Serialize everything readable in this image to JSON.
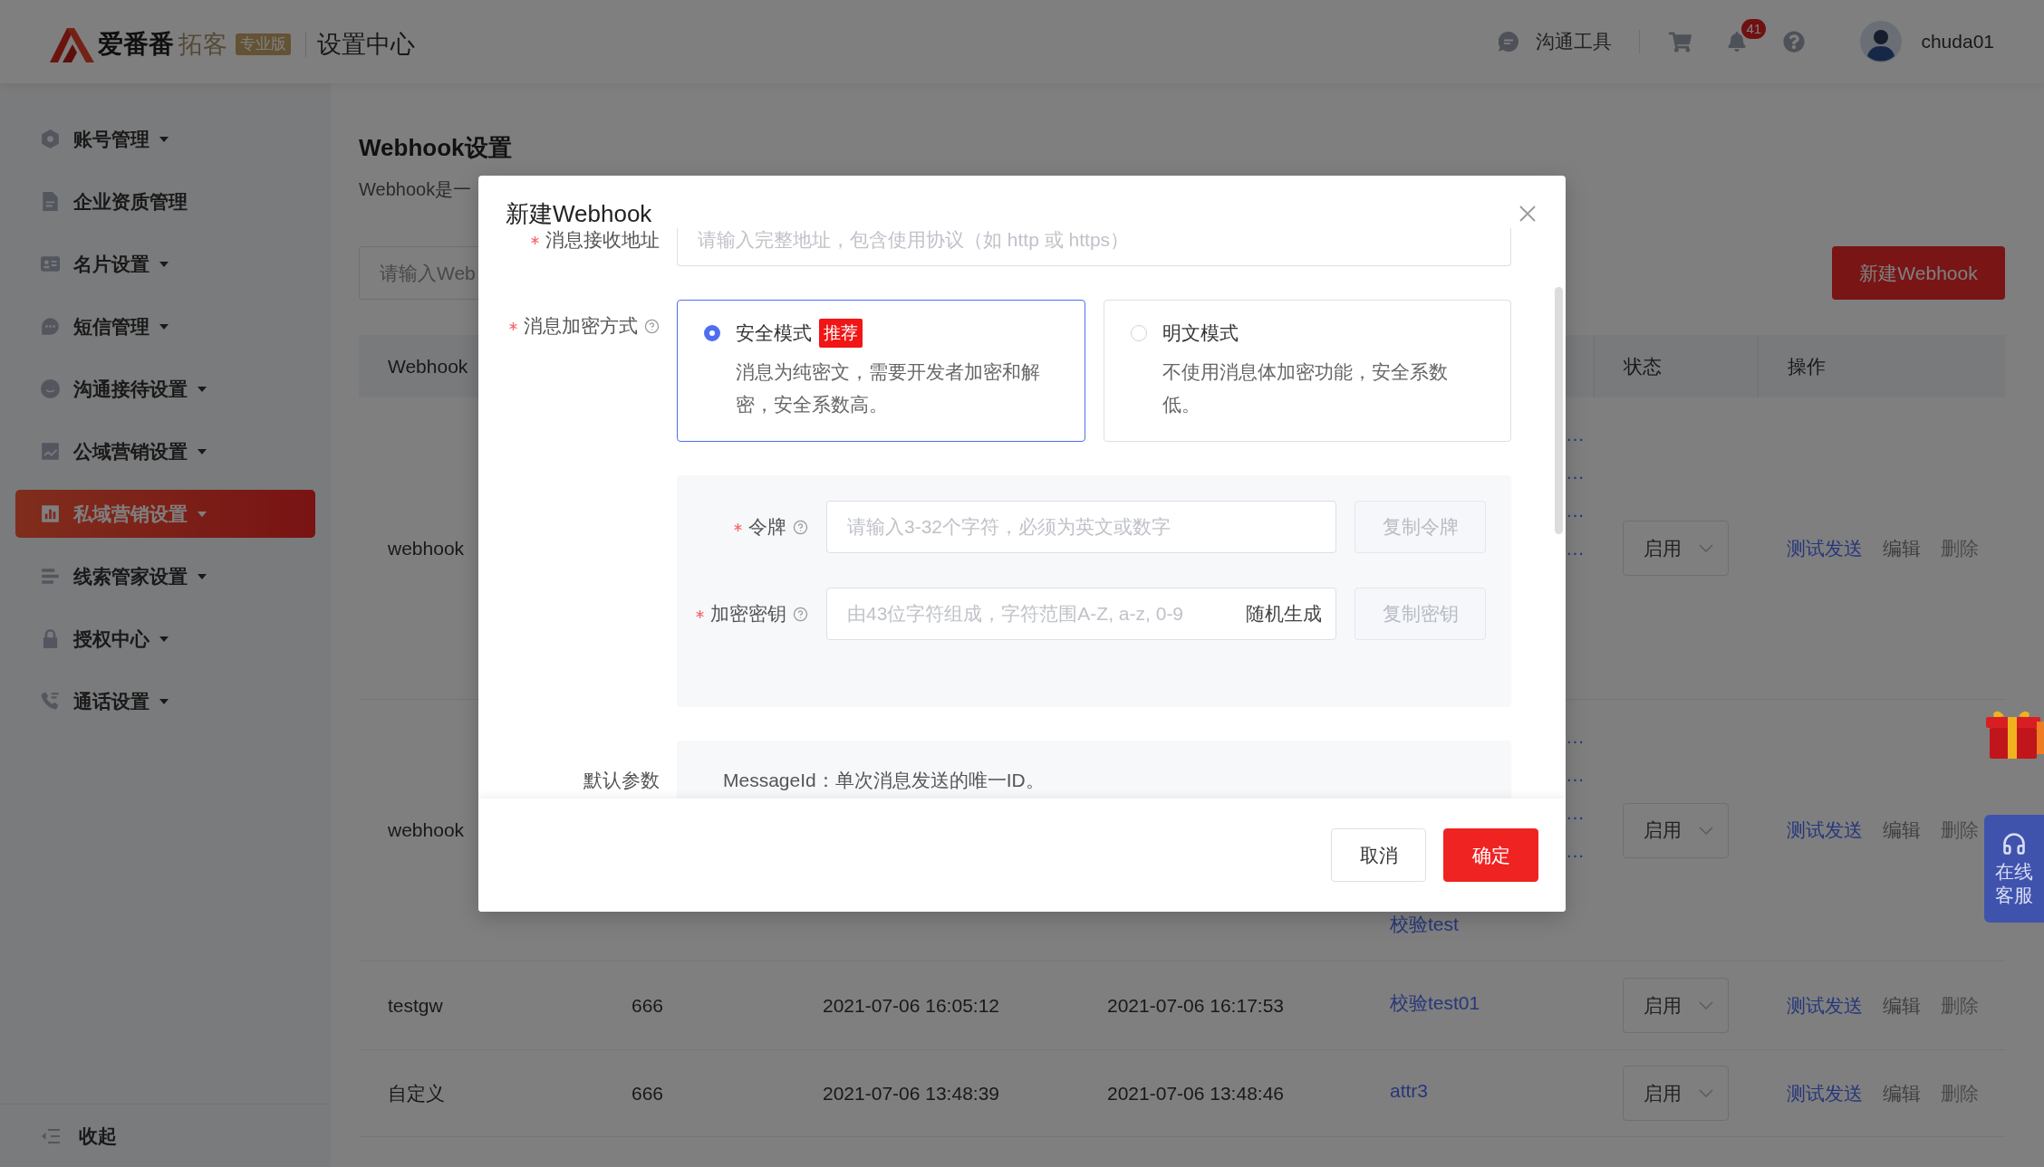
{
  "header": {
    "brand": "爱番番",
    "product": "拓客",
    "edition": "专业版",
    "title": "设置中心",
    "chat_tool": "沟通工具",
    "notification_count": "41",
    "user_name": "chuda01"
  },
  "sidebar": {
    "items": [
      {
        "label": "账号管理",
        "has_submenu": true,
        "selected": false
      },
      {
        "label": "企业资质管理",
        "has_submenu": false,
        "selected": false
      },
      {
        "label": "名片设置",
        "has_submenu": true,
        "selected": false
      },
      {
        "label": "短信管理",
        "has_submenu": true,
        "selected": false
      },
      {
        "label": "沟通接待设置",
        "has_submenu": true,
        "selected": false
      },
      {
        "label": "公域营销设置",
        "has_submenu": true,
        "selected": false
      },
      {
        "label": "私域营销设置",
        "has_submenu": true,
        "selected": true
      },
      {
        "label": "线索管家设置",
        "has_submenu": true,
        "selected": false
      },
      {
        "label": "授权中心",
        "has_submenu": true,
        "selected": false
      },
      {
        "label": "通话设置",
        "has_submenu": true,
        "selected": false
      }
    ],
    "collapse": "收起"
  },
  "content": {
    "title": "Webhook设置",
    "description": "Webhook是一",
    "search": {
      "placeholder": "请输入Web"
    },
    "create_button": "新建Webhook",
    "table": {
      "headers": {
        "column_1": "Webhook",
        "status": "状态",
        "actions": "操作"
      },
      "rows": [
        {
          "column_1": "webhook",
          "column_5": {
            "truncated": [
              "…",
              "…",
              "…",
              "…"
            ]
          },
          "status": "启用",
          "actions": [
            {
              "label": "测试发送",
              "kind": "primary"
            },
            {
              "label": "编辑",
              "kind": "default"
            },
            {
              "label": "删除",
              "kind": "muted"
            }
          ]
        },
        {
          "column_1": "webhook",
          "column_5": {
            "truncated": [
              "…",
              "…",
              "…",
              "…"
            ],
            "link": "校验test"
          },
          "status": "启用",
          "actions": [
            {
              "label": "测试发送",
              "kind": "primary"
            },
            {
              "label": "编辑",
              "kind": "default"
            },
            {
              "label": "删除",
              "kind": "muted"
            }
          ]
        },
        {
          "column_1": "testgw",
          "column_2": "666",
          "column_3": "2021-07-06 16:05:12",
          "column_4": "2021-07-06 16:17:53",
          "column_5": {
            "link": "校验test01"
          },
          "status": "启用",
          "actions": [
            {
              "label": "测试发送",
              "kind": "primary"
            },
            {
              "label": "编辑",
              "kind": "default"
            },
            {
              "label": "删除",
              "kind": "muted"
            }
          ]
        },
        {
          "column_1": "自定义",
          "column_2": "666",
          "column_3": "2021-07-06 13:48:39",
          "column_4": "2021-07-06 13:48:46",
          "column_5": {
            "link": "attr3"
          },
          "status": "启用",
          "actions": [
            {
              "label": "测试发送",
              "kind": "primary"
            },
            {
              "label": "编辑",
              "kind": "default"
            },
            {
              "label": "删除",
              "kind": "muted"
            }
          ]
        }
      ]
    }
  },
  "modal": {
    "title": "新建Webhook",
    "fields": [
      {
        "kind": "input",
        "label": "消息接收地址",
        "required": true,
        "help": false,
        "placeholder": "请输入完整地址，包含使用协议（如 http 或 https）"
      },
      {
        "kind": "radio_cards",
        "label": "消息加密方式",
        "required": true,
        "help": true,
        "options": [
          {
            "title": "安全模式",
            "badge": "推荐",
            "description": "消息为纯密文，需要开发者加密和解密，安全系数高。",
            "selected": true
          },
          {
            "title": "明文模式",
            "description": "不使用消息体加密功能，安全系数低。",
            "selected": false
          }
        ]
      },
      {
        "kind": "credentials",
        "rows": [
          {
            "label": "令牌",
            "required": true,
            "help": true,
            "placeholder": "请输入3-32个字符，必须为英文或数字",
            "button": {
              "label": "复制令牌",
              "disabled": true
            }
          },
          {
            "label": "加密密钥",
            "required": true,
            "help": true,
            "placeholder": "由43位字符组成，字符范围A-Z, a-z, 0-9",
            "suffix": "随机生成",
            "button": {
              "label": "复制密钥",
              "disabled": true
            }
          }
        ]
      },
      {
        "kind": "info",
        "label": "默认参数",
        "required": false,
        "help": false,
        "text": "MessageId：单次消息发送的唯一ID。"
      }
    ],
    "buttons": [
      {
        "label": "取消",
        "kind": "default"
      },
      {
        "label": "确定",
        "kind": "primary"
      }
    ]
  },
  "service_button": "在线客服"
}
